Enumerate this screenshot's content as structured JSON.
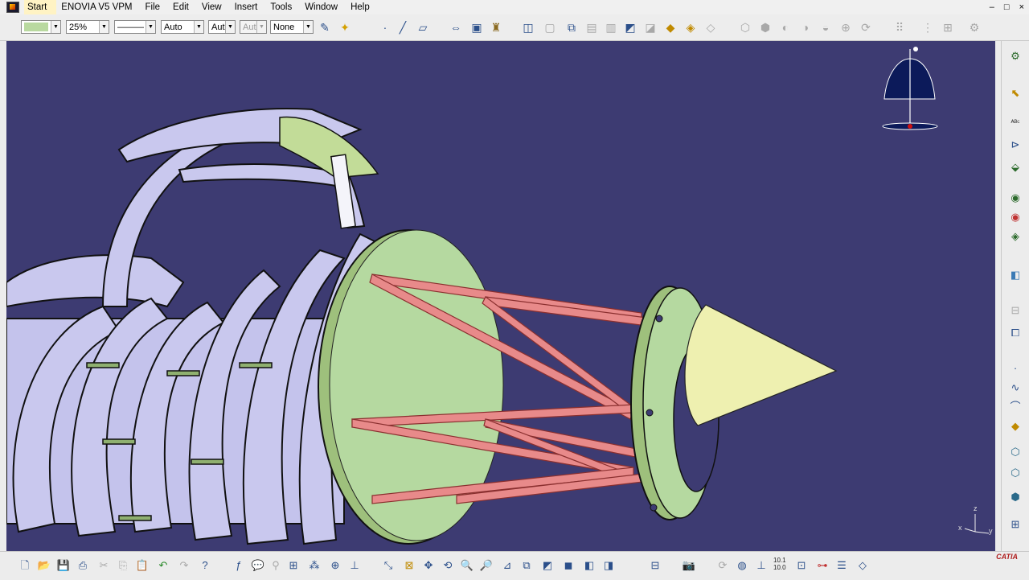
{
  "menubar": {
    "items": [
      "Start",
      "ENOVIA V5 VPM",
      "File",
      "Edit",
      "View",
      "Insert",
      "Tools",
      "Window",
      "Help"
    ],
    "controls": [
      "–",
      "□",
      "×"
    ]
  },
  "toolbar": {
    "fill_color": "#b9d9a0",
    "transparency": "25%",
    "line_type": "———",
    "line_weight": "Auto",
    "layer_a": "Aut",
    "layer_b": "Aut",
    "render_style": "None"
  },
  "compass": {
    "axis_labels": [
      "z",
      "y",
      "x"
    ]
  },
  "bottom": {
    "ratio_top": "10.1",
    "ratio_bottom": "10.0",
    "brand": "CATIA"
  },
  "colors": {
    "viewport_bg": "#3d3b72",
    "part_lavender": "#c9c8ee",
    "part_green": "#b5d9a0",
    "strut_red": "#e88a8a",
    "cone_yellow": "#eef0b0"
  }
}
